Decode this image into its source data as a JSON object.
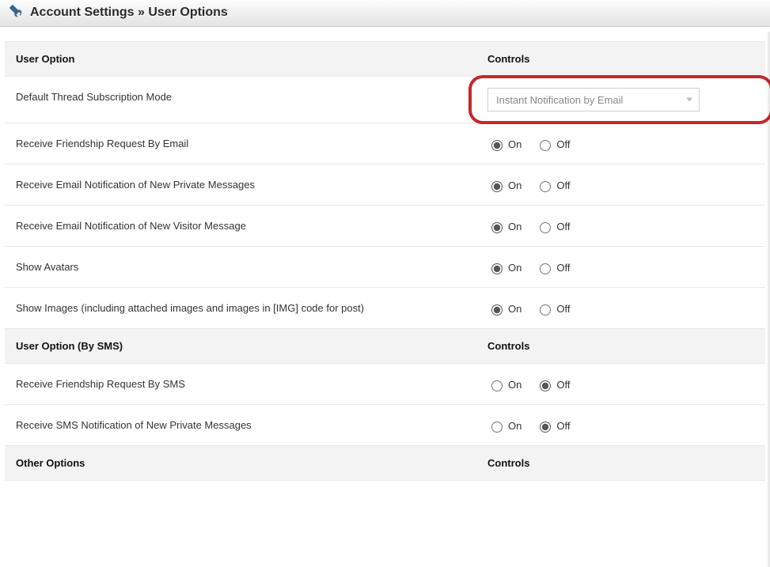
{
  "title": "Account Settings » User Options",
  "headers": {
    "option": "User Option",
    "option_sms": "User Option (By SMS)",
    "option_other": "Other Options",
    "controls": "Controls"
  },
  "labels": {
    "on": "On",
    "off": "Off"
  },
  "options": {
    "default_thread_sub": {
      "label": "Default Thread Subscription Mode",
      "selected": "Instant Notification by Email"
    },
    "friend_req_email": {
      "label": "Receive Friendship Request By Email",
      "value": "on"
    },
    "email_pm": {
      "label": "Receive Email Notification of New Private Messages",
      "value": "on"
    },
    "email_visitor": {
      "label": "Receive Email Notification of New Visitor Message",
      "value": "on"
    },
    "show_avatars": {
      "label": "Show Avatars",
      "value": "on"
    },
    "show_images": {
      "label": "Show Images (including attached images and images in [IMG] code for post)",
      "value": "on"
    },
    "friend_req_sms": {
      "label": "Receive Friendship Request By SMS",
      "value": "off"
    },
    "sms_pm": {
      "label": "Receive SMS Notification of New Private Messages",
      "value": "off"
    }
  }
}
